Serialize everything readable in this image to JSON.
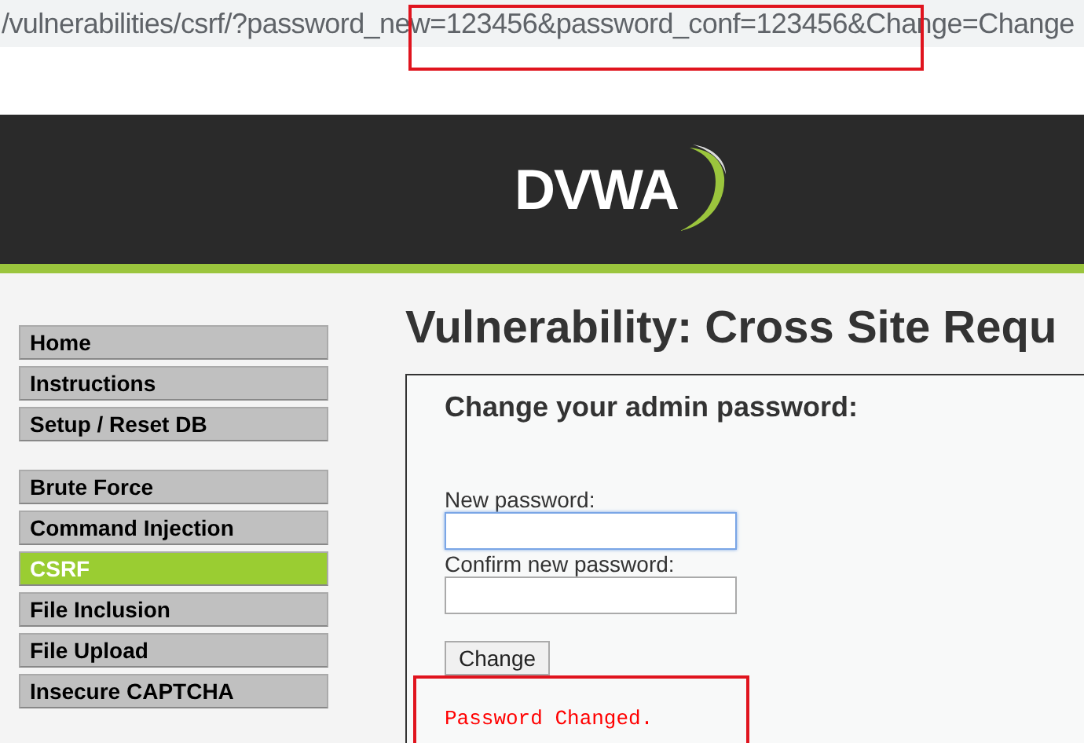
{
  "address_bar": {
    "url": "/vulnerabilities/csrf/?password_new=123456&password_conf=123456&Change=Change"
  },
  "header": {
    "logo": "DVWA"
  },
  "menu": [
    {
      "items": [
        {
          "label": "Home",
          "selected": false
        },
        {
          "label": "Instructions",
          "selected": false
        },
        {
          "label": "Setup / Reset DB",
          "selected": false
        }
      ]
    },
    {
      "items": [
        {
          "label": "Brute Force",
          "selected": false
        },
        {
          "label": "Command Injection",
          "selected": false
        },
        {
          "label": "CSRF",
          "selected": true
        },
        {
          "label": "File Inclusion",
          "selected": false
        },
        {
          "label": "File Upload",
          "selected": false
        },
        {
          "label": "Insecure CAPTCHA",
          "selected": false
        }
      ]
    }
  ],
  "page_title": "Vulnerability: Cross Site Requ",
  "form": {
    "heading": "Change your admin password:",
    "fields": [
      {
        "label": "New password:",
        "focused": true
      },
      {
        "label": "Confirm new password:",
        "focused": false
      }
    ],
    "button": "Change",
    "message": "Password Changed."
  }
}
